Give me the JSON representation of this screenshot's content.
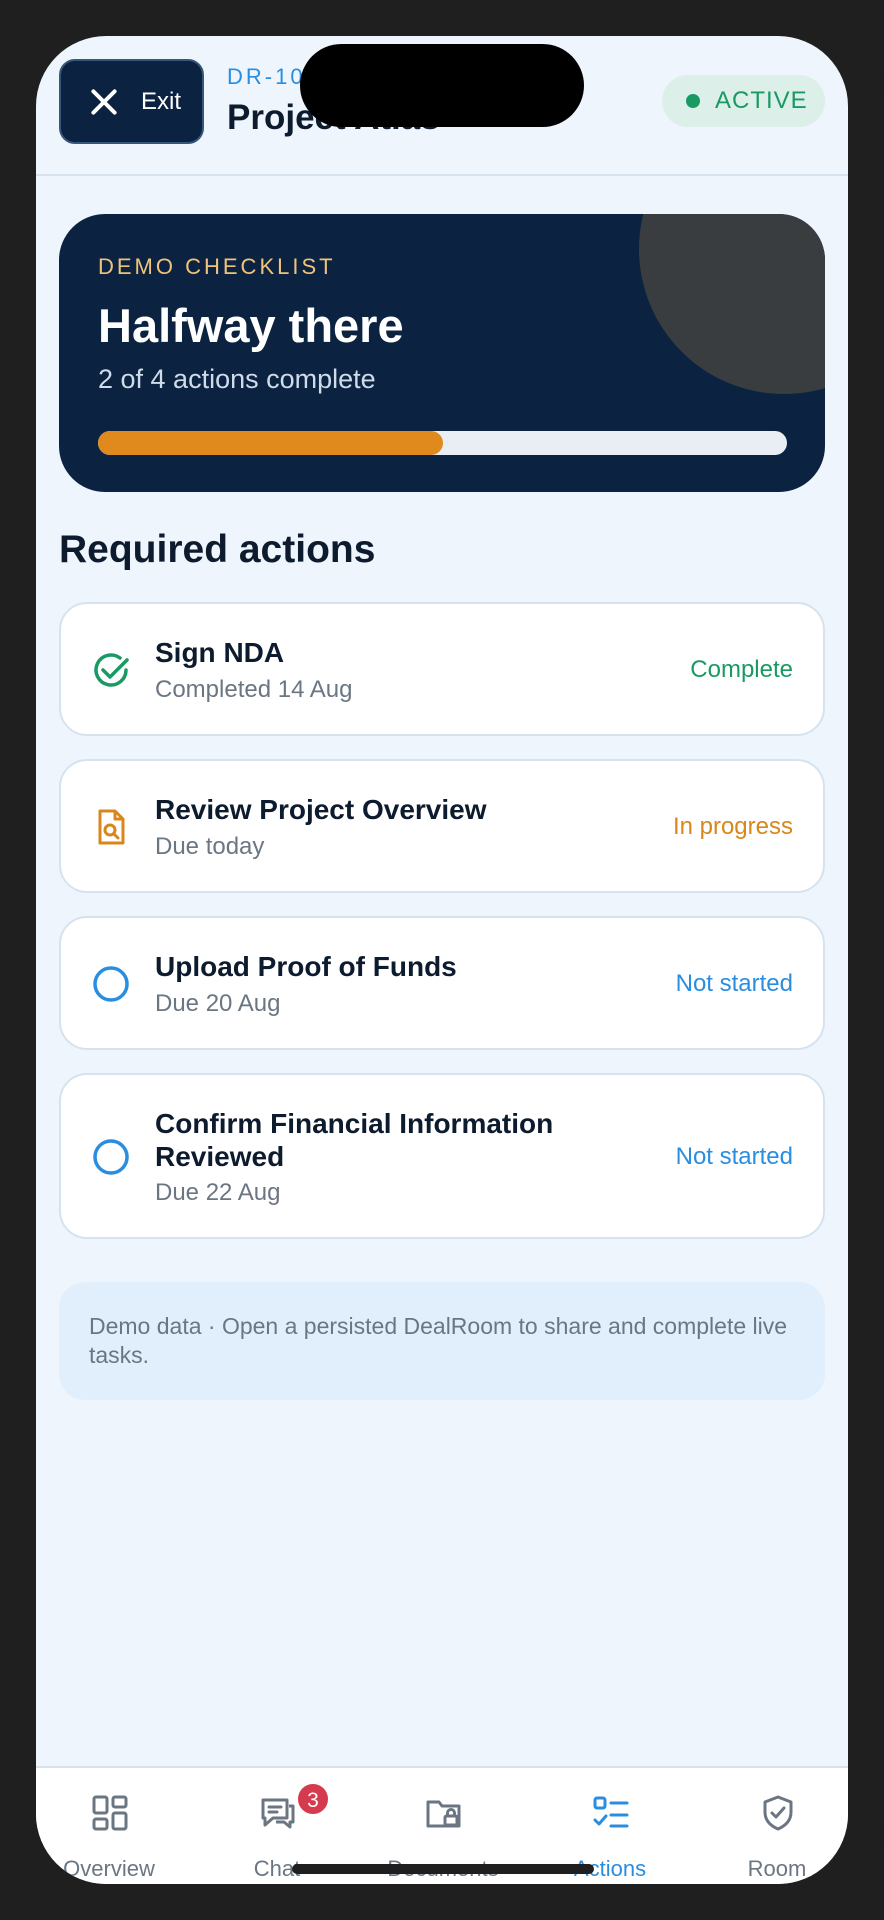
{
  "header": {
    "exit_label": "Exit",
    "deal_code": "DR-10",
    "deal_name": "Project Atlas",
    "status": "ACTIVE"
  },
  "hero": {
    "eyebrow": "DEMO CHECKLIST",
    "title": "Halfway there",
    "subtitle": "2 of 4 actions complete",
    "progress_fraction": 0.5
  },
  "section_title": "Required actions",
  "actions": [
    {
      "title": "Sign NDA",
      "sub": "Completed 14 Aug",
      "status": "Complete",
      "icon": "check-circle-icon"
    },
    {
      "title": "Review Project Overview",
      "sub": "Due today",
      "status": "In progress",
      "icon": "document-search-icon"
    },
    {
      "title": "Upload Proof of Funds",
      "sub": "Due 20 Aug",
      "status": "Not started",
      "icon": "empty-circle-icon"
    },
    {
      "title": "Confirm Financial Information Reviewed",
      "sub": "Due 22 Aug",
      "status": "Not started",
      "icon": "empty-circle-icon"
    }
  ],
  "note": "Demo data · Open a persisted DealRoom to share and complete live tasks.",
  "nav": {
    "items": [
      {
        "label": "Overview",
        "icon": "grid-icon"
      },
      {
        "label": "Chat",
        "icon": "chat-icon",
        "badge": "3"
      },
      {
        "label": "Documents",
        "icon": "folder-lock-icon"
      },
      {
        "label": "Actions",
        "icon": "checklist-icon",
        "active": true
      },
      {
        "label": "Room",
        "icon": "shield-check-icon"
      }
    ]
  },
  "colors": {
    "navy": "#0b2341",
    "accent_blue": "#2a8ee0",
    "accent_orange": "#e08a1e",
    "success_green": "#1a9a63",
    "badge_red": "#d53a4e"
  }
}
